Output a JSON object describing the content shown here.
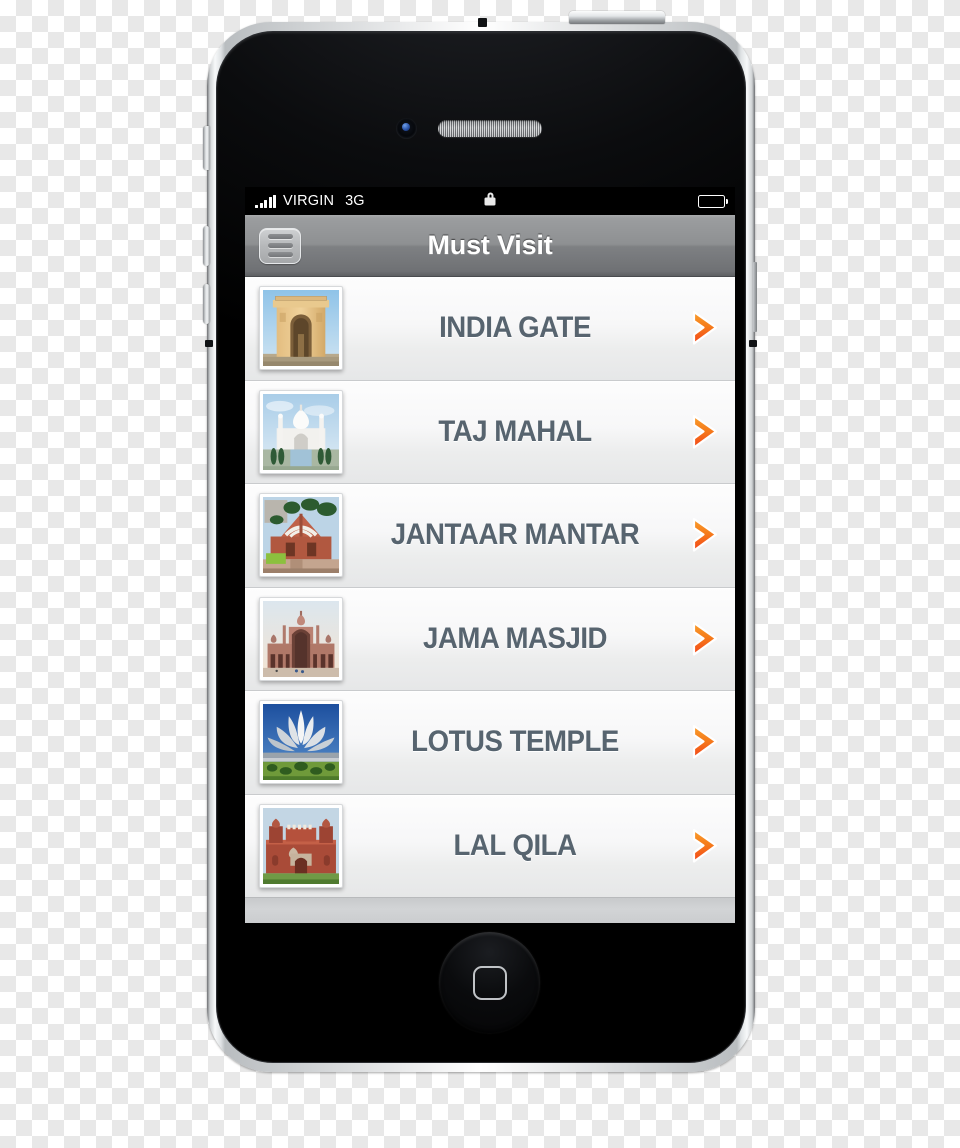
{
  "statusbar": {
    "carrier": "VIRGIN",
    "network": "3G",
    "signal_bars": 5,
    "lock_icon": "lock-icon",
    "battery_icon": "battery-icon"
  },
  "navbar": {
    "title": "Must Visit",
    "menu_icon": "hamburger-menu-icon"
  },
  "list": {
    "items": [
      {
        "title": "INDIA GATE",
        "thumb": "india-gate-thumbnail",
        "chevron": "chevron-right-icon"
      },
      {
        "title": "TAJ MAHAL",
        "thumb": "taj-mahal-thumbnail",
        "chevron": "chevron-right-icon"
      },
      {
        "title": "JANTAAR MANTAR",
        "thumb": "jantaar-mantar-thumbnail",
        "chevron": "chevron-right-icon"
      },
      {
        "title": "JAMA MASJID",
        "thumb": "jama-masjid-thumbnail",
        "chevron": "chevron-right-icon"
      },
      {
        "title": "LOTUS TEMPLE",
        "thumb": "lotus-temple-thumbnail",
        "chevron": "chevron-right-icon"
      },
      {
        "title": "LAL QILA",
        "thumb": "lal-qila-thumbnail",
        "chevron": "chevron-right-icon"
      }
    ]
  },
  "device": {
    "home_button": "home-button",
    "power_button": "power-button",
    "volume_up_button": "volume-up-button",
    "volume_down_button": "volume-down-button",
    "silent_switch": "silent-switch",
    "front_camera": "front-camera",
    "earpiece_speaker": "earpiece-speaker"
  },
  "colors": {
    "accent_orange": "#f4801a",
    "accent_orange_deep": "#f4511e",
    "title_slate": "#57646f",
    "navbar_gray": "#8e9092",
    "row_bg": "#f7f7f8"
  }
}
